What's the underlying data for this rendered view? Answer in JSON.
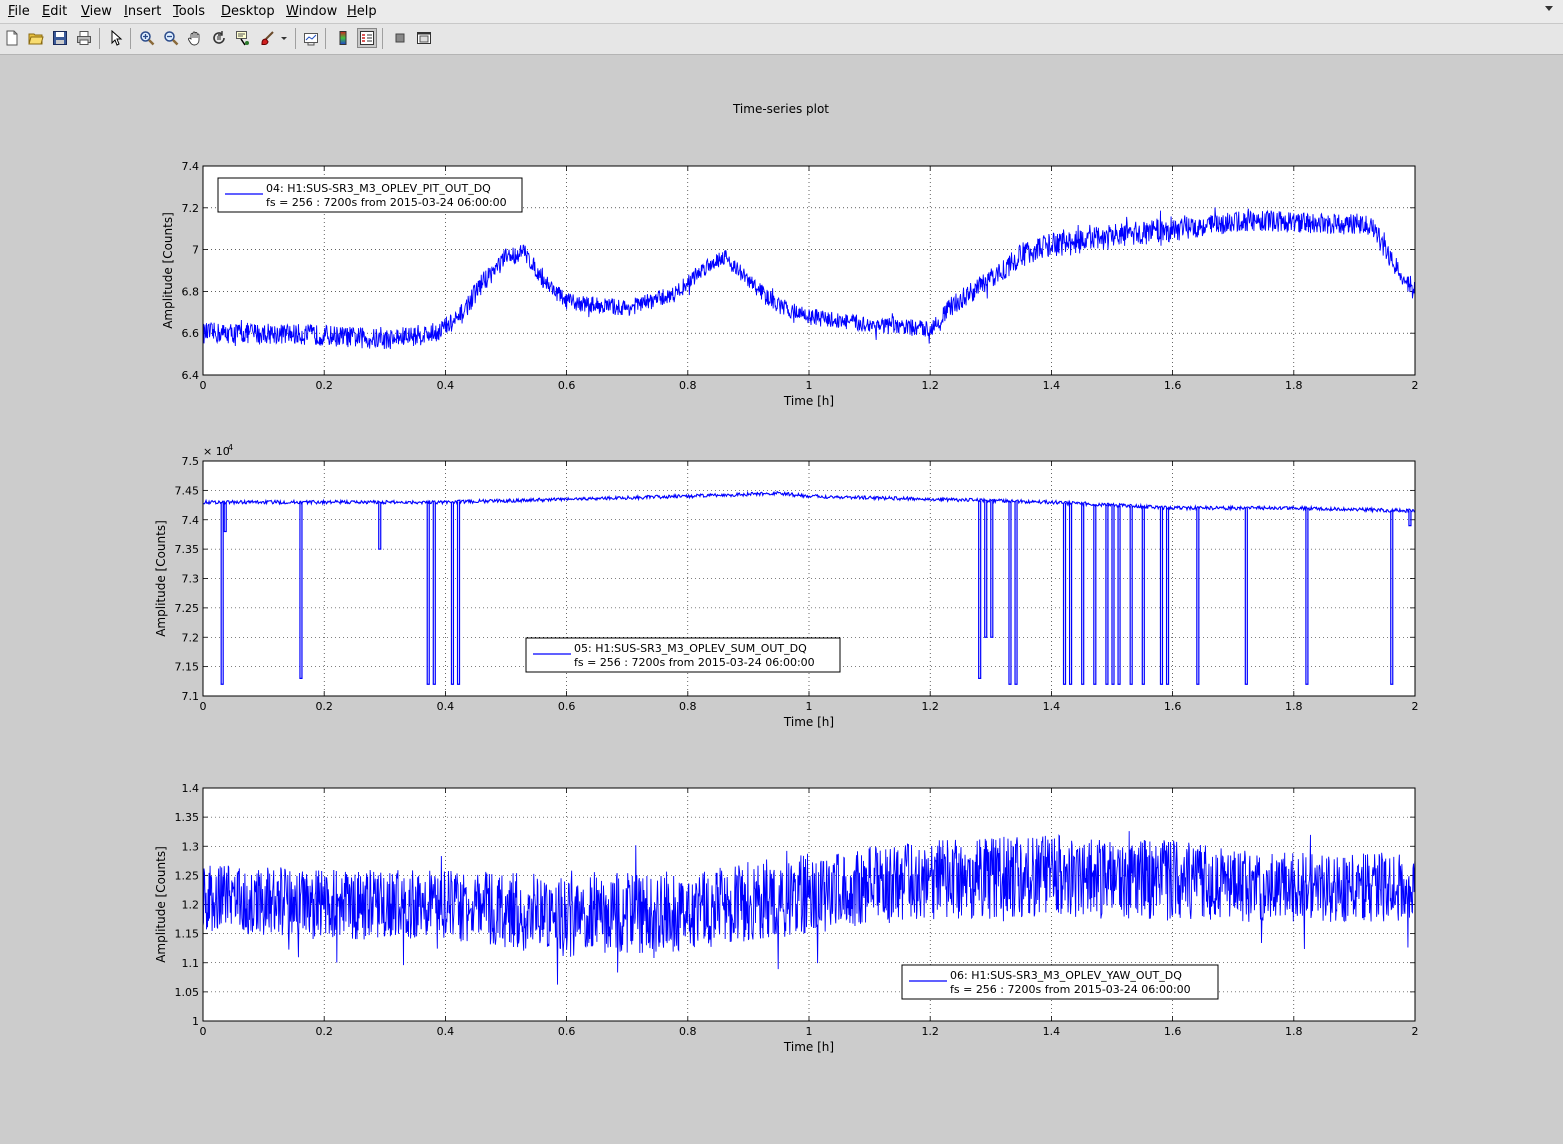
{
  "menu": {
    "items": [
      {
        "label": "File",
        "key": "F"
      },
      {
        "label": "Edit",
        "key": "E"
      },
      {
        "label": "View",
        "key": "V"
      },
      {
        "label": "Insert",
        "key": "I"
      },
      {
        "label": "Tools",
        "key": "T"
      },
      {
        "label": "Desktop",
        "key": "D"
      },
      {
        "label": "Window",
        "key": "W"
      },
      {
        "label": "Help",
        "key": "H"
      }
    ]
  },
  "toolbar": {
    "buttons": [
      "new-figure",
      "open-file",
      "save-figure",
      "print-figure",
      "edit-plot",
      "zoom-in",
      "zoom-out",
      "pan",
      "rotate-3d",
      "data-cursor",
      "brush",
      "link-plot",
      "insert-colorbar",
      "insert-legend",
      "hide-plot-tools",
      "show-plot-tools"
    ]
  },
  "figure": {
    "title": "Time-series plot",
    "line_color": "#0000ff"
  },
  "chart_data": [
    {
      "type": "line",
      "title": "",
      "xlabel": "Time [h]",
      "ylabel": "Amplitude [Counts]",
      "xlim": [
        0,
        2
      ],
      "ylim": [
        6.4,
        7.4
      ],
      "xticks": [
        "0",
        "0.2",
        "0.4",
        "0.6",
        "0.8",
        "1",
        "1.2",
        "1.4",
        "1.6",
        "1.8",
        "2"
      ],
      "yticks": [
        "6.4",
        "6.6",
        "6.8",
        "7",
        "7.2",
        "7.4"
      ],
      "grid": true,
      "legend_position": "top-left",
      "legend": {
        "channel": "04: H1:SUS-SR3_M3_OPLEV_PIT_OUT_DQ",
        "info": "fs = 256 : 7200s from 2015-03-24 06:00:00"
      },
      "series": [
        {
          "name": "04: H1:SUS-SR3_M3_OPLEV_PIT_OUT_DQ",
          "x": [
            0,
            0.1,
            0.2,
            0.3,
            0.38,
            0.42,
            0.46,
            0.5,
            0.53,
            0.56,
            0.6,
            0.7,
            0.78,
            0.83,
            0.86,
            0.9,
            0.95,
            1.0,
            1.1,
            1.2,
            1.24,
            1.3,
            1.36,
            1.4,
            1.5,
            1.6,
            1.7,
            1.75,
            1.8,
            1.9,
            1.93,
            1.96,
            2.0
          ],
          "y": [
            6.6,
            6.6,
            6.59,
            6.57,
            6.6,
            6.66,
            6.84,
            6.96,
            6.99,
            6.86,
            6.75,
            6.72,
            6.79,
            6.92,
            6.97,
            6.85,
            6.73,
            6.68,
            6.64,
            6.62,
            6.74,
            6.86,
            6.99,
            7.02,
            7.06,
            7.1,
            7.13,
            7.14,
            7.13,
            7.12,
            7.11,
            6.95,
            6.8
          ],
          "band": [
            0.05,
            0.05,
            0.05,
            0.05,
            0.05,
            0.05,
            0.05,
            0.05,
            0.04,
            0.04,
            0.04,
            0.04,
            0.04,
            0.04,
            0.04,
            0.04,
            0.04,
            0.04,
            0.04,
            0.04,
            0.05,
            0.05,
            0.06,
            0.06,
            0.06,
            0.06,
            0.05,
            0.05,
            0.05,
            0.05,
            0.05,
            0.05,
            0.05
          ]
        }
      ]
    },
    {
      "type": "line",
      "title": "",
      "xlabel": "Time [h]",
      "ylabel": "Amplitude [Counts]",
      "y_exponent": "× 10^4",
      "xlim": [
        0,
        2
      ],
      "ylim": [
        7.1,
        7.5
      ],
      "xticks": [
        "0",
        "0.2",
        "0.4",
        "0.6",
        "0.8",
        "1",
        "1.2",
        "1.4",
        "1.6",
        "1.8",
        "2"
      ],
      "yticks": [
        "7.1",
        "7.15",
        "7.2",
        "7.25",
        "7.3",
        "7.35",
        "7.4",
        "7.45",
        "7.5"
      ],
      "grid": true,
      "legend_position": "bottom-center",
      "legend": {
        "channel": "05: H1:SUS-SR3_M3_OPLEV_SUM_OUT_DQ",
        "info": "fs = 256 : 7200s from 2015-03-24 06:00:00"
      },
      "series": [
        {
          "name": "05: H1:SUS-SR3_M3_OPLEV_SUM_OUT_DQ",
          "x": [
            0,
            0.2,
            0.4,
            0.6,
            0.8,
            0.95,
            1.0,
            1.2,
            1.4,
            1.6,
            1.8,
            2.0
          ],
          "y": [
            7.43,
            7.43,
            7.43,
            7.435,
            7.44,
            7.445,
            7.44,
            7.435,
            7.43,
            7.42,
            7.42,
            7.415
          ],
          "dips": [
            [
              0.03,
              7.12
            ],
            [
              0.035,
              7.38
            ],
            [
              0.16,
              7.13
            ],
            [
              0.29,
              7.35
            ],
            [
              0.37,
              7.12
            ],
            [
              0.38,
              7.12
            ],
            [
              0.41,
              7.12
            ],
            [
              0.42,
              7.12
            ],
            [
              1.28,
              7.13
            ],
            [
              1.29,
              7.2
            ],
            [
              1.3,
              7.2
            ],
            [
              1.33,
              7.12
            ],
            [
              1.34,
              7.12
            ],
            [
              1.42,
              7.12
            ],
            [
              1.43,
              7.12
            ],
            [
              1.45,
              7.12
            ],
            [
              1.47,
              7.12
            ],
            [
              1.49,
              7.12
            ],
            [
              1.5,
              7.12
            ],
            [
              1.51,
              7.12
            ],
            [
              1.53,
              7.12
            ],
            [
              1.55,
              7.12
            ],
            [
              1.58,
              7.12
            ],
            [
              1.59,
              7.12
            ],
            [
              1.64,
              7.12
            ],
            [
              1.72,
              7.12
            ],
            [
              1.82,
              7.12
            ],
            [
              1.96,
              7.12
            ],
            [
              1.99,
              7.39
            ]
          ]
        }
      ]
    },
    {
      "type": "line",
      "title": "",
      "xlabel": "Time [h]",
      "ylabel": "Amplitude [Counts]",
      "xlim": [
        0,
        2
      ],
      "ylim": [
        1,
        1.4
      ],
      "xticks": [
        "0",
        "0.2",
        "0.4",
        "0.6",
        "0.8",
        "1",
        "1.2",
        "1.4",
        "1.6",
        "1.8",
        "2"
      ],
      "yticks": [
        "1",
        "1.05",
        "1.1",
        "1.15",
        "1.2",
        "1.25",
        "1.3",
        "1.35",
        "1.4"
      ],
      "grid": true,
      "legend_position": "bottom-right",
      "legend": {
        "channel": "06: H1:SUS-SR3_M3_OPLEV_YAW_OUT_DQ",
        "info": "fs = 256 : 7200s from 2015-03-24 06:00:00"
      },
      "series": [
        {
          "name": "06: H1:SUS-SR3_M3_OPLEV_YAW_OUT_DQ",
          "x": [
            0,
            0.2,
            0.4,
            0.6,
            0.8,
            1.0,
            1.2,
            1.4,
            1.6,
            1.8,
            2.0
          ],
          "y": [
            1.21,
            1.2,
            1.2,
            1.18,
            1.19,
            1.22,
            1.24,
            1.25,
            1.24,
            1.23,
            1.23
          ],
          "band": [
            0.06,
            0.06,
            0.06,
            0.07,
            0.07,
            0.07,
            0.07,
            0.07,
            0.07,
            0.06,
            0.06
          ]
        }
      ]
    }
  ]
}
